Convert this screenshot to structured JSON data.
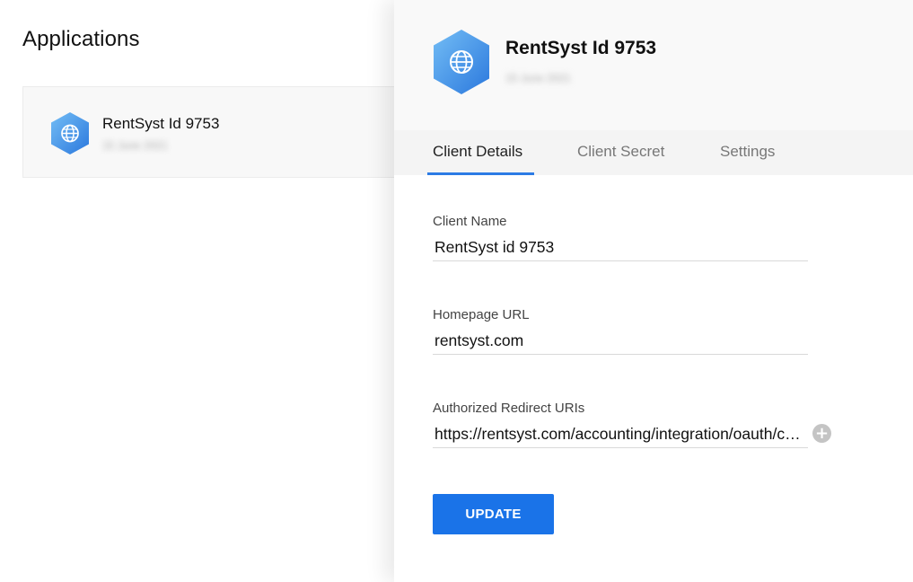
{
  "list": {
    "title": "Applications",
    "apps": [
      {
        "name": "RentSyst Id 9753",
        "subtitle": "15 June 2021"
      }
    ]
  },
  "detail": {
    "app_name": "RentSyst Id 9753",
    "app_subtitle": "15 June 2021",
    "tabs": [
      {
        "label": "Client Details",
        "active": true
      },
      {
        "label": "Client Secret",
        "active": false
      },
      {
        "label": "Settings",
        "active": false
      }
    ],
    "form": {
      "client_name_label": "Client Name",
      "client_name_value": "RentSyst id 9753",
      "homepage_url_label": "Homepage URL",
      "homepage_url_value": "rentsyst.com",
      "redirect_uris_label": "Authorized Redirect URIs",
      "redirect_uri_value": "https://rentsyst.com/accounting/integration/oauth/callback",
      "add_symbol": "+",
      "update_label": "UPDATE"
    }
  },
  "colors": {
    "accent": "#1a73e8",
    "tab_underline": "#2c7be5",
    "hex_icon_light": "#6fb6f3",
    "hex_icon_dark": "#2f7fe0"
  },
  "icons": {
    "app_icon": "globe-icon",
    "add_redirect": "plus-circle-icon"
  }
}
